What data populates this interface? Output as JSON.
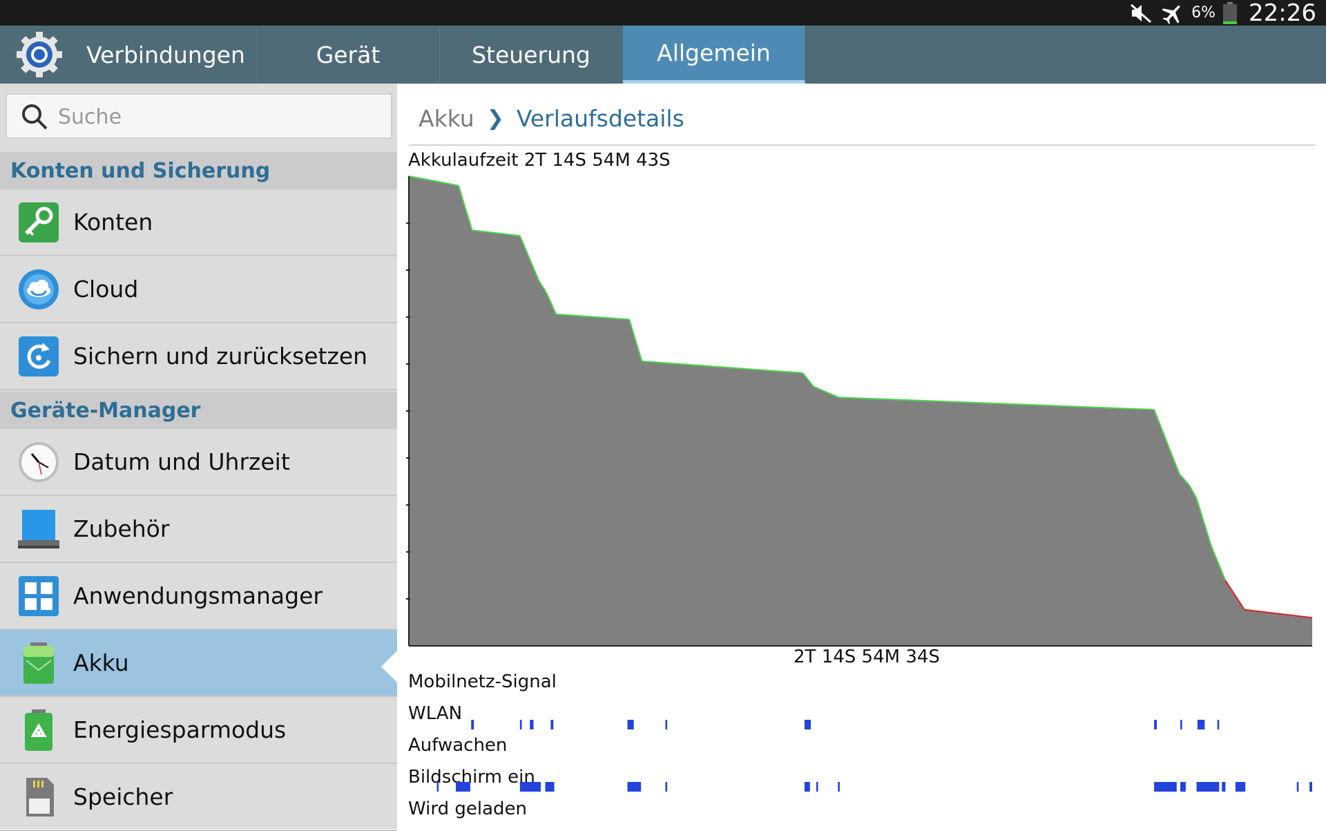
{
  "status": {
    "battery": "6%",
    "time": "22:26"
  },
  "tabs": [
    {
      "label": "Verbindungen"
    },
    {
      "label": "Gerät"
    },
    {
      "label": "Steuerung"
    },
    {
      "label": "Allgemein",
      "active": true
    }
  ],
  "search": {
    "placeholder": "Suche"
  },
  "sidebar": {
    "sections": [
      {
        "label": "Konten und Sicherung"
      },
      {
        "label": "Geräte-Manager"
      }
    ],
    "items": [
      {
        "label": "Konten",
        "icon": "key-icon"
      },
      {
        "label": "Cloud",
        "icon": "cloud-icon"
      },
      {
        "label": "Sichern und zurücksetzen",
        "icon": "backup-icon"
      },
      {
        "label": "Datum und Uhrzeit",
        "icon": "clock-icon"
      },
      {
        "label": "Zubehör",
        "icon": "accessory-icon"
      },
      {
        "label": "Anwendungsmanager",
        "icon": "apps-grid-icon"
      },
      {
        "label": "Akku",
        "icon": "battery-icon",
        "selected": true
      },
      {
        "label": "Energiesparmodus",
        "icon": "recycle-battery-icon"
      },
      {
        "label": "Speicher",
        "icon": "sd-card-icon"
      }
    ]
  },
  "breadcrumb": {
    "parent": "Akku",
    "current": "Verlaufsdetails"
  },
  "colors": {
    "selected": "#9ac4df",
    "accent": "#2e6e96",
    "tabbar": "#4f6b78",
    "tab_active": "#4d8bb4",
    "chart_fill": "#808080",
    "line_ok": "#4cd64c",
    "line_low": "#e02020",
    "track": "#2244dd"
  },
  "chart_data": {
    "type": "area",
    "title": "Akkulaufzeit 2T 14S 54M 43S",
    "xlabel": "2T 14S 54M 34S",
    "ylim": [
      0,
      100
    ],
    "x_unit_percent_of_runtime": true,
    "x": [
      0,
      5.5,
      7,
      12.3,
      14.4,
      15.2,
      16.3,
      24.4,
      25.8,
      43.6,
      44.8,
      47.6,
      82.5,
      85.3,
      86.4,
      87.2,
      88.8,
      90.4,
      92.5,
      100
    ],
    "y": [
      100,
      98,
      88.5,
      87.3,
      77.7,
      75.3,
      70.6,
      69.5,
      60.6,
      58.1,
      55.2,
      52.9,
      50.3,
      36.6,
      34.2,
      31.4,
      21.4,
      13.9,
      7.7,
      6
    ],
    "low_threshold": 14,
    "tracks": [
      {
        "label": "Mobilnetz-Signal",
        "bars": []
      },
      {
        "label": "WLAN",
        "bars": [
          [
            6.9,
            0.3
          ],
          [
            12.3,
            0.2
          ],
          [
            13.4,
            0.4
          ],
          [
            15.7,
            0.3
          ],
          [
            24.2,
            0.7
          ],
          [
            28.4,
            0.2
          ],
          [
            43.8,
            0.7
          ],
          [
            82.5,
            0.3
          ],
          [
            85.4,
            0.2
          ],
          [
            87.3,
            0.8
          ],
          [
            89.5,
            0.2
          ]
        ]
      },
      {
        "label": "Aufwachen",
        "bars": []
      },
      {
        "label": "Bildschirm ein",
        "bars": [
          [
            3.1,
            0.2
          ],
          [
            5.2,
            1.6
          ],
          [
            12.3,
            2.3
          ],
          [
            15.1,
            1.0
          ],
          [
            24.2,
            1.5
          ],
          [
            28.4,
            0.2
          ],
          [
            43.8,
            0.6
          ],
          [
            45.1,
            0.2
          ],
          [
            47.5,
            0.2
          ],
          [
            82.5,
            2.5
          ],
          [
            85.4,
            0.6
          ],
          [
            87.2,
            2.5
          ],
          [
            90.0,
            0.4
          ],
          [
            91.5,
            1.1
          ],
          [
            98.3,
            0.2
          ],
          [
            99.7,
            0.3
          ]
        ]
      },
      {
        "label": "Wird geladen",
        "bars": []
      }
    ]
  }
}
